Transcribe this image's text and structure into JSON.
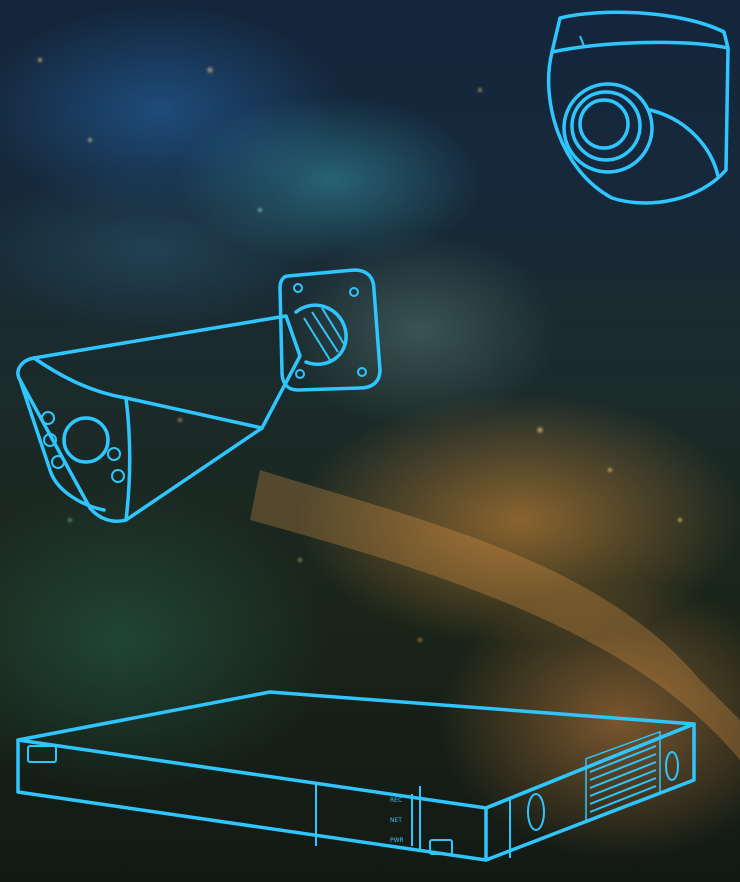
{
  "image": {
    "colors": {
      "outline": "#2fc6ff",
      "background_dark": "#0b1420"
    }
  },
  "recorder": {
    "led_labels": [
      "REC",
      "NET",
      "PWR"
    ]
  },
  "icons": [
    "dome-camera-icon",
    "bullet-camera-icon",
    "network-video-recorder-icon"
  ]
}
